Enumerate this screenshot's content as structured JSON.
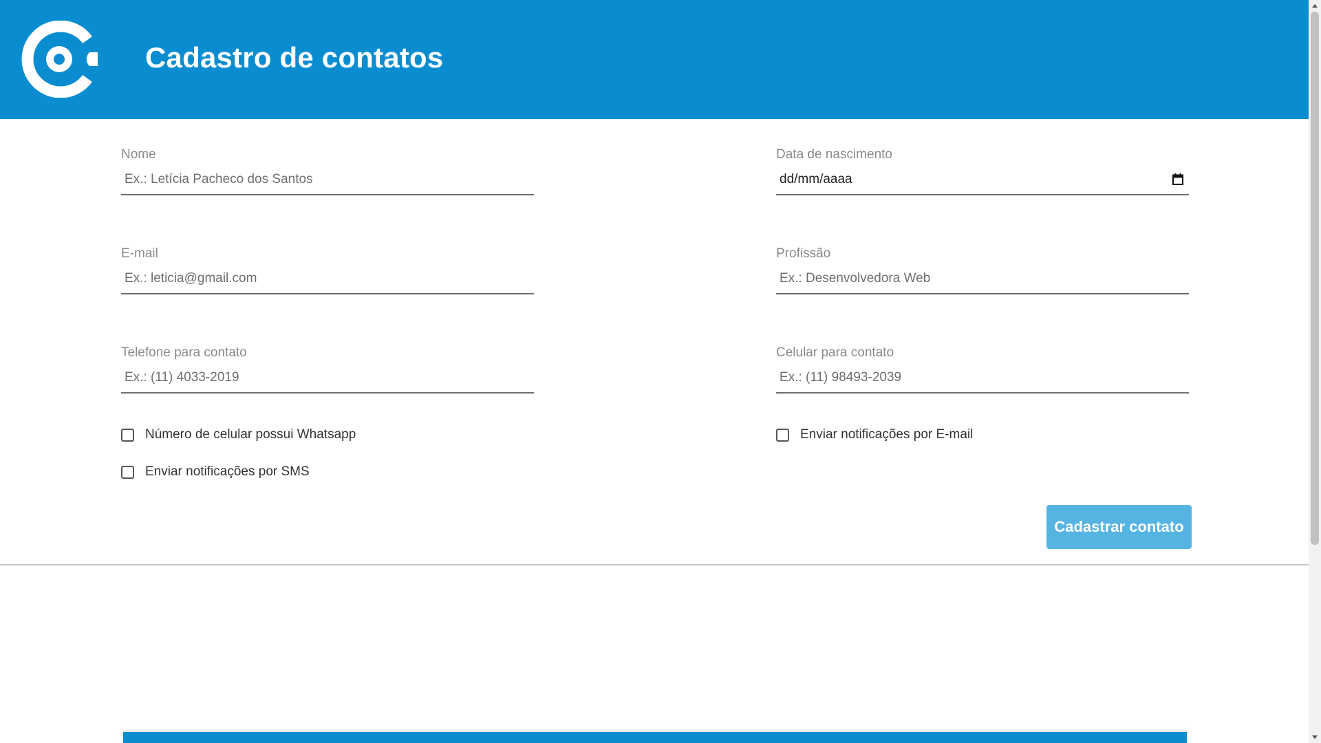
{
  "header": {
    "title": "Cadastro de contatos",
    "background_color": "#0a8dd0",
    "logo_icon": "logo-icon"
  },
  "form": {
    "name": {
      "label": "Nome",
      "placeholder": "Ex.: Letícia Pacheco dos Santos"
    },
    "birthdate": {
      "label": "Data de nascimento",
      "value": "dd/mm/aaaa",
      "icon": "calendar-icon"
    },
    "email": {
      "label": "E-mail",
      "placeholder": "Ex.: leticia@gmail.com"
    },
    "profession": {
      "label": "Profissão",
      "placeholder": "Ex.: Desenvolvedora Web"
    },
    "phone": {
      "label": "Telefone para contato",
      "placeholder": "Ex.: (11) 4033-2019"
    },
    "mobile": {
      "label": "Celular para contato",
      "placeholder": "Ex.: (11) 98493-2039"
    },
    "checkboxes": {
      "whatsapp": {
        "label": "Número de celular possui Whatsapp",
        "checked": false
      },
      "email_notify": {
        "label": "Enviar notificações por E-mail",
        "checked": false
      },
      "sms_notify": {
        "label": "Enviar notificações por SMS",
        "checked": false
      }
    },
    "submit_label": "Cadastrar contato",
    "submit_color": "#56b4e3"
  }
}
